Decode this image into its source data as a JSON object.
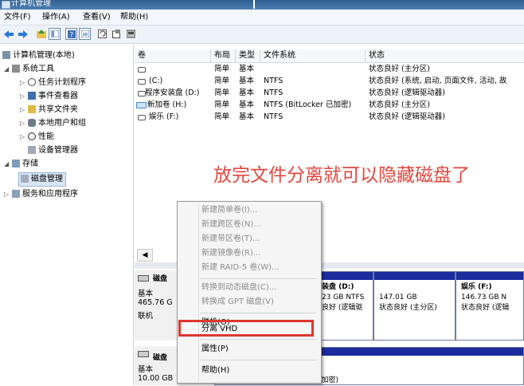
{
  "window": {
    "title": "计算机管理"
  },
  "menu": [
    "文件(F)",
    "操作(A)",
    "查看(V)",
    "帮助(H)"
  ],
  "toolbar": {
    "icons": [
      "back-icon",
      "forward-icon",
      "up-folder-icon",
      "show-hide-tree-icon",
      "help-icon",
      "console-view-icon",
      "refresh-icon",
      "properties-icon",
      "disk-icon"
    ]
  },
  "tree": [
    {
      "label": "计算机管理(本地)",
      "icon": "computer-management-icon"
    },
    {
      "label": "系统工具",
      "icon": "tools-icon"
    },
    {
      "label": "任务计划程序",
      "icon": "clock-icon"
    },
    {
      "label": "事件查看器",
      "icon": "event-viewer-icon"
    },
    {
      "label": "共享文件夹",
      "icon": "shared-folder-icon"
    },
    {
      "label": "本地用户和组",
      "icon": "users-icon"
    },
    {
      "label": "性能",
      "icon": "performance-icon"
    },
    {
      "label": "设备管理器",
      "icon": "device-manager-icon"
    },
    {
      "label": "存储",
      "icon": "storage-icon"
    },
    {
      "label": "磁盘管理",
      "icon": "disk-management-icon"
    },
    {
      "label": "服务和应用程序",
      "icon": "services-icon"
    }
  ],
  "volume_table": {
    "headers": [
      "卷",
      "布局",
      "类型",
      "文件系统",
      "状态"
    ],
    "rows": [
      {
        "volume": "",
        "layout": "简单",
        "type": "基本",
        "fs": "",
        "status": "状态良好 (主分区)"
      },
      {
        "volume": "(C:)",
        "layout": "简单",
        "type": "基本",
        "fs": "NTFS",
        "status": "状态良好 (系统, 启动, 页面文件, 活动, 故"
      },
      {
        "volume": "程序安装盘 (D:)",
        "layout": "简单",
        "type": "基本",
        "fs": "NTFS",
        "status": "状态良好 (逻辑驱动器)"
      },
      {
        "volume": "新加卷 (H:)",
        "layout": "简单",
        "type": "基本",
        "fs": "NTFS (BitLocker 已加密)",
        "status": "状态良好 (主分区)"
      },
      {
        "volume": "娱乐 (F:)",
        "layout": "简单",
        "type": "基本",
        "fs": "NTFS",
        "status": "状态良好 (逻辑驱动器)"
      }
    ]
  },
  "annotation": "放完文件分离就可以隐藏磁盘了",
  "disks": {
    "disk0": {
      "label": "磁盘",
      "type": "基本",
      "size": "465.76 G",
      "state": "联机",
      "partitions": [
        {
          "name": "装盘 (D:)",
          "size": "23 GB NTFS",
          "status": "良好 (逻辑驱"
        },
        {
          "name": "",
          "size": "147.01 GB",
          "status": "状态良好 (主分区)"
        },
        {
          "name": "娱乐 (F:)",
          "size": "146.73 GB N",
          "status": "状态良好 (逻辑"
        }
      ]
    },
    "disk1": {
      "label": "磁盘",
      "type": "基本",
      "size": "10.00 GB",
      "partition_text": "10.00 GB NTFS (BitLocker 已加密)"
    }
  },
  "context_menu": {
    "items": [
      {
        "label": "新建简单卷(I)...",
        "enabled": false
      },
      {
        "label": "新建跨区卷(N)...",
        "enabled": false
      },
      {
        "label": "新建带区卷(T)...",
        "enabled": false
      },
      {
        "label": "新建镜像卷(R)...",
        "enabled": false
      },
      {
        "label": "新建 RAID-5 卷(W)...",
        "enabled": false
      },
      {
        "label": "转换到动态磁盘(C)...",
        "enabled": false
      },
      {
        "label": "转换成 GPT 磁盘(V)",
        "enabled": false
      },
      {
        "label": "脱机(O)",
        "enabled": true
      },
      {
        "label": "分离 VHD",
        "enabled": true
      },
      {
        "label": "属性(P)",
        "enabled": true
      },
      {
        "label": "帮助(H)",
        "enabled": true
      }
    ]
  },
  "colors": {
    "accent": "#e2463d",
    "partition_bar": "#1b2c9d",
    "highlight_box": "#e0362f"
  }
}
